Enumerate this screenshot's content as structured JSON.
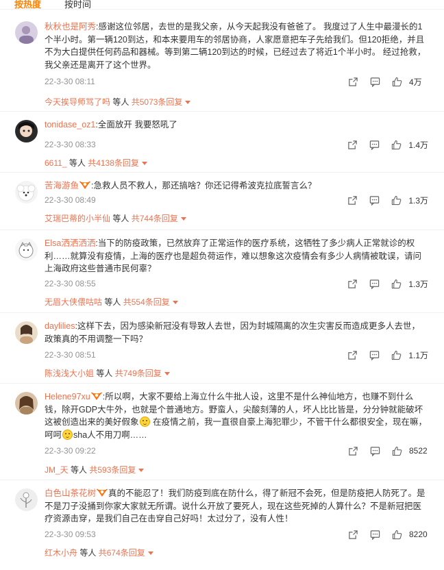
{
  "tabs": {
    "hot": "按热度",
    "time": "按时间"
  },
  "comments": [
    {
      "user": "秋秋也是阿秀",
      "text": ":感谢这位邻居，去世的是我父亲，从今天起我没有爸爸了。 我度过了人生中最漫长的1个半小时。第一辆120到达，和本来要用车的邻居协商，人家愿意把车子先给我们。但120拒绝，并且不为大白提供任何药品和器械。等到第二辆120到达的时候，已经过去了将近1个半小时。 经过抢救，我父亲还是离开了这个世界。",
      "time": "22-3-30 08:11",
      "likes": "4万",
      "reply_user": "今天挨导师骂了吗",
      "reply_mid": "等人",
      "reply_count": "共5073条回复"
    },
    {
      "user": "tonidase_oz1",
      "text": ":全面放开 我要怒吼了",
      "time": "22-3-30 08:33",
      "likes": "1.4万",
      "reply_user": "6611_",
      "reply_mid": "等人",
      "reply_count": "共4138条回复"
    },
    {
      "user": "苦海游鱼",
      "text": ":急救人员不救人，那还搞啥？你还记得希波克拉底誓言么？",
      "time": "22-3-30 08:49",
      "likes": "1.3万",
      "reply_user": "艾瑞巴蒂的小半仙",
      "reply_mid": "等人",
      "reply_count": "共744条回复"
    },
    {
      "user": "Elsa洒洒洒洒",
      "text": ":当下的防疫政策，已然放弃了正常运作的医疗系统，这牺牲了多少病人正常就诊的权利……就算没有疫情，上海的医疗也是超负荷运作，难以想象这次疫情会有多少人病情被耽误，请问上海政府这些普通市民何辜？",
      "time": "22-3-30 08:55",
      "likes": "1.3万",
      "reply_user": "无眉大侠偎咕咕",
      "reply_mid": "等人",
      "reply_count": "共554条回复"
    },
    {
      "user": "daylilies",
      "text": ":这样下去，因为感染新冠没有导致人去世，因为封城隔离的次生灾害反而造成更多人去世，政策真的不用调整一下吗？",
      "time": "22-3-30 08:51",
      "likes": "1.1万",
      "reply_user": "陈浅浅大小姐",
      "reply_mid": "等人",
      "reply_count": "共749条回复"
    },
    {
      "user": "Helene97xu",
      "text_a": ":所以啊，大家不要给上海立什么牛批人设，这里不是什么神仙地方，也赚不到什么钱，除开GDP大牛外，也就是个普通地方。野蛮人，尖酸刻薄的人，坏人比比皆是，分分钟就能破坏这被创造出来的美好假象",
      "text_b": " 在疫情之前，我一直很自豪上海犯罪少，不管干什么都很安全，现在嘛，呵呵",
      "text_c": "sha人不用刀啊……",
      "time": "22-3-30 09:22",
      "likes": "8522",
      "reply_user": "JM_天",
      "reply_mid": "等人",
      "reply_count": "共593条回复"
    },
    {
      "user": "白色山茶花树",
      "text": "真的不能忍了！我们防疫到底在防什么，得了新冠不会死，但是防疫把人防死了。是不是刀子没捅到你家大家就无所谓。说什么开放了要死人，现在这些死掉的人算什么？不是新冠把医疗资源击穿，是我们自己在击穿自己好吗！太过分了，没有人性！",
      "time": "22-3-30 09:53",
      "likes": "8220",
      "reply_user": "红木小舟",
      "reply_mid": "等人",
      "reply_count": "共674条回复"
    }
  ]
}
